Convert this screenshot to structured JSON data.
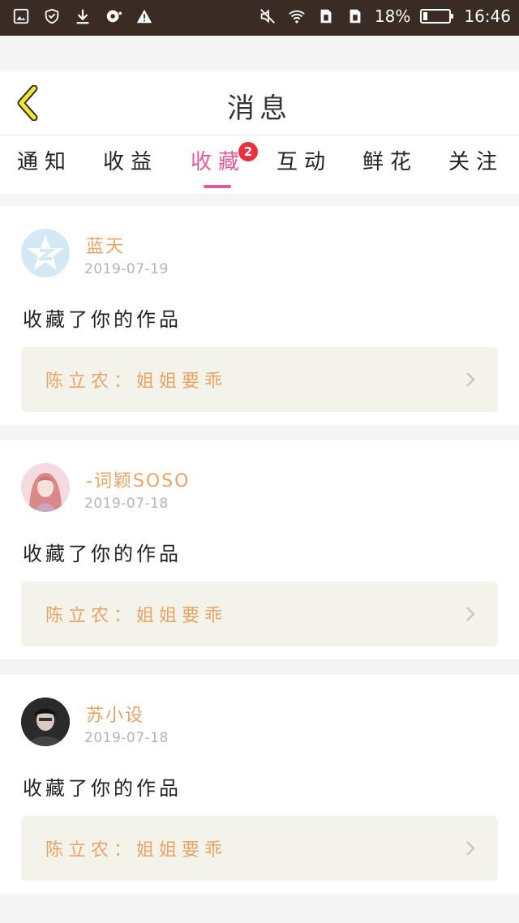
{
  "status_bar": {
    "left_icons": [
      "gallery-icon",
      "shield-icon",
      "download-icon",
      "sync-icon",
      "warning-icon"
    ],
    "right_icons": [
      "mute-icon",
      "wifi-icon",
      "sim1-icon",
      "sim2-icon"
    ],
    "battery_percent": "18%",
    "battery_level": 0.18,
    "time": "16:46"
  },
  "header": {
    "title": "消息",
    "back_icon": "chevron-left-icon"
  },
  "tabs": [
    {
      "label": "通知",
      "active": false
    },
    {
      "label": "收益",
      "active": false
    },
    {
      "label": "收藏",
      "active": true,
      "badge": "2"
    },
    {
      "label": "互动",
      "active": false
    },
    {
      "label": "鲜花",
      "active": false
    },
    {
      "label": "关注",
      "active": false
    }
  ],
  "colors": {
    "accent": "#e05a9d",
    "name": "#e8a468",
    "badge": "#e8313c"
  },
  "cards": [
    {
      "user": "蓝天",
      "date": "2019-07-19",
      "action": "收藏了你的作品",
      "work": "陈立农：姐姐要乖",
      "avatar": "qq-default-avatar"
    },
    {
      "user": "-词颖SOSO",
      "date": "2019-07-18",
      "action": "收藏了你的作品",
      "work": "陈立农：姐姐要乖",
      "avatar": "girl-illustration-avatar"
    },
    {
      "user": "苏小设",
      "date": "2019-07-18",
      "action": "收藏了你的作品",
      "work": "陈立农：姐姐要乖",
      "avatar": "dark-photo-avatar"
    }
  ]
}
